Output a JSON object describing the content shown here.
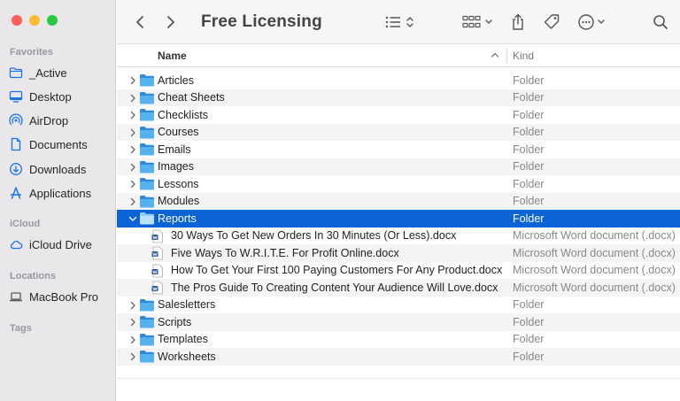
{
  "window": {
    "title": "Free Licensing"
  },
  "colors": {
    "selection": "#0b64d6",
    "folder": "#4fa3e3",
    "sidebar_icon": "#1a73e8"
  },
  "sidebar": {
    "favorites_title": "Favorites",
    "favorites": [
      {
        "label": "_Active",
        "icon": "folder-icon"
      },
      {
        "label": "Desktop",
        "icon": "desktop-icon"
      },
      {
        "label": "AirDrop",
        "icon": "airdrop-icon"
      },
      {
        "label": "Documents",
        "icon": "document-icon"
      },
      {
        "label": "Downloads",
        "icon": "download-icon"
      },
      {
        "label": "Applications",
        "icon": "applications-icon"
      }
    ],
    "icloud_title": "iCloud",
    "icloud": [
      {
        "label": "iCloud Drive",
        "icon": "cloud-icon"
      }
    ],
    "locations_title": "Locations",
    "locations": [
      {
        "label": "MacBook Pro",
        "icon": "laptop-icon"
      }
    ],
    "tags_title": "Tags"
  },
  "header": {
    "name": "Name",
    "kind": "Kind"
  },
  "rows": [
    {
      "name": "Articles",
      "kind": "Folder"
    },
    {
      "name": "Cheat Sheets",
      "kind": "Folder"
    },
    {
      "name": "Checklists",
      "kind": "Folder"
    },
    {
      "name": "Courses",
      "kind": "Folder"
    },
    {
      "name": "Emails",
      "kind": "Folder"
    },
    {
      "name": "Images",
      "kind": "Folder"
    },
    {
      "name": "Lessons",
      "kind": "Folder"
    },
    {
      "name": "Modules",
      "kind": "Folder"
    },
    {
      "name": "Reports",
      "kind": "Folder"
    },
    {
      "name": "30 Ways To Get New Orders In 30 Minutes (Or Less).docx",
      "kind": "Microsoft Word document (.docx)"
    },
    {
      "name": "Five Ways To W.R.I.T.E. For Profit Online.docx",
      "kind": "Microsoft Word document (.docx)"
    },
    {
      "name": "How To Get Your First 100 Paying Customers For Any Product.docx",
      "kind": "Microsoft Word document (.docx)"
    },
    {
      "name": "The Pros Guide To Creating Content Your Audience Will Love.docx",
      "kind": "Microsoft Word document (.docx)"
    },
    {
      "name": "Salesletters",
      "kind": "Folder"
    },
    {
      "name": "Scripts",
      "kind": "Folder"
    },
    {
      "name": "Templates",
      "kind": "Folder"
    },
    {
      "name": "Worksheets",
      "kind": "Folder"
    }
  ]
}
